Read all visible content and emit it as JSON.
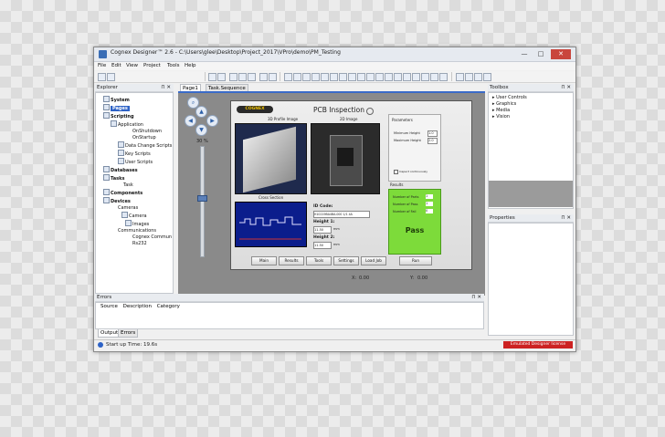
{
  "window": {
    "title": "Cognex Designer™ 2.6 - C:\\Users\\glee\\Desktop\\Project_2017\\VPro\\demo\\PM_Testing",
    "minimize": "—",
    "maximize": "□",
    "close": "✕"
  },
  "menu": [
    "File",
    "Edit",
    "View",
    "Project",
    "Tools",
    "Help"
  ],
  "explorer": {
    "title": "Explorer",
    "items": [
      {
        "label": "System",
        "bold": true
      },
      {
        "label": "Pages",
        "bold": true,
        "selected": true
      },
      {
        "label": "Scripting",
        "bold": true
      },
      {
        "label": "Application"
      },
      {
        "label": "OnShutdown"
      },
      {
        "label": "OnStartup"
      },
      {
        "label": "Data Change Scripts"
      },
      {
        "label": "Key Scripts"
      },
      {
        "label": "User Scripts"
      },
      {
        "label": "Databases",
        "bold": true
      },
      {
        "label": "Tasks",
        "bold": true
      },
      {
        "label": "Task"
      },
      {
        "label": "Components",
        "bold": true
      },
      {
        "label": "Devices",
        "bold": true
      },
      {
        "label": "Cameras"
      },
      {
        "label": "Camera"
      },
      {
        "label": "Images"
      },
      {
        "label": "Communications"
      },
      {
        "label": "Cognex Commun"
      },
      {
        "label": "Rs232"
      }
    ]
  },
  "tabs": {
    "page1": "Page1",
    "sequence": "Task.Sequence"
  },
  "zoom": {
    "label": "30 %",
    "value": 30
  },
  "hmi": {
    "logo": "COGNEX",
    "title": "PCB Inspection",
    "profile_caption": "3D Profile Image",
    "image2d_caption": "2D Image",
    "cross_caption": "Cross Section",
    "parameters_title": "Parameters",
    "param1": "Minimum Height",
    "param2": "Maximum Height",
    "param_value1": "1.0",
    "param_value2": "2.0",
    "inspect_label": "Inspect continuously",
    "id_label": "ID Code:",
    "id_value": "H10219BA4BA-000 1/1 4A",
    "height1_label": "Height 1:",
    "height1_value": "11.50",
    "height1_unit": "mm",
    "height2_label": "Height 2:",
    "height2_value": "11.50",
    "height2_unit": "mm",
    "results_title": "Results",
    "res1": "Number of Parts",
    "res2": "Number of Pass",
    "res3": "Number of Fail",
    "res_v1": "1",
    "res_v2": "1",
    "res_v3": "0",
    "pass_label": "Pass",
    "buttons": [
      "Main",
      "Results",
      "Tools",
      "Settings",
      "Load Job",
      "Run"
    ]
  },
  "coords": {
    "x_label": "X:",
    "x_value": "0.00",
    "y_label": "Y:",
    "y_value": "0.00"
  },
  "toolbox": {
    "title": "Toolbox",
    "items": [
      "User Controls",
      "Graphics",
      "Media",
      "Vision"
    ]
  },
  "properties": {
    "title": "Properties"
  },
  "errors": {
    "title": "Errors",
    "columns": [
      "Source",
      "Description",
      "Category"
    ],
    "tabs": [
      "Output",
      "Errors"
    ]
  },
  "status": {
    "text": "Start up Time: 19.6s",
    "badge": "Emulated Designer license",
    "badge_color": "#cc2222"
  },
  "colors": {
    "selection": "#2d62c6",
    "pass_green": "#7ddb3a",
    "plot_blue": "#0b1d8c"
  }
}
